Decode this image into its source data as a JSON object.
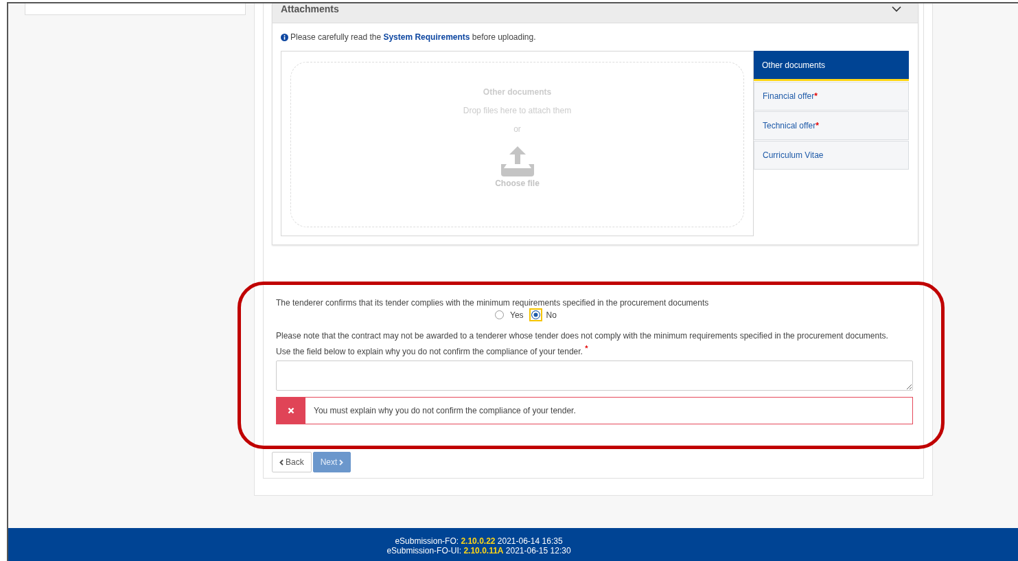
{
  "attachments": {
    "title": "Attachments",
    "notice_before": "Please carefully read the",
    "link": "System Requirements",
    "notice_after": "before uploading.",
    "dropzone": {
      "title": "Other documents",
      "hint": "Drop files here to attach them",
      "or": "or",
      "button": "Choose file"
    },
    "categories": [
      {
        "label": "Other documents",
        "selected": true
      },
      {
        "label": "Financial offer",
        "mark": "*",
        "selected": false
      },
      {
        "label": "Technical offer",
        "mark": "*",
        "selected": false
      },
      {
        "label": "Curriculum Vitae",
        "selected": false
      }
    ]
  },
  "question": {
    "text": "The tenderer confirms that its tender complies with the minimum requirements specified in the procurement documents",
    "options": [
      {
        "label": "Yes",
        "selected": false
      },
      {
        "label": "No",
        "selected": true
      }
    ],
    "note": "Please note that the contract may not be awarded to a tenderer whose tender does not comply with the minimum requirements specified in the procurement documents.",
    "explain_label": "Use the field below to explain why you do not confirm the compliance of your tender.",
    "required_mark": "*",
    "error": "You must explain why you do not confirm the compliance of your tender."
  },
  "buttons": [
    {
      "label": "Back",
      "kind": "back",
      "disabled": false
    },
    {
      "label": "Next",
      "kind": "next",
      "disabled": true
    }
  ],
  "footer": [
    {
      "name": "eSubmission-FO:",
      "version": "2.10.0.22",
      "date": "2021-06-14 16:35"
    },
    {
      "name": "eSubmission-FO-UI:",
      "version": "2.10.0.11A",
      "date": "2021-06-15 12:30"
    }
  ]
}
